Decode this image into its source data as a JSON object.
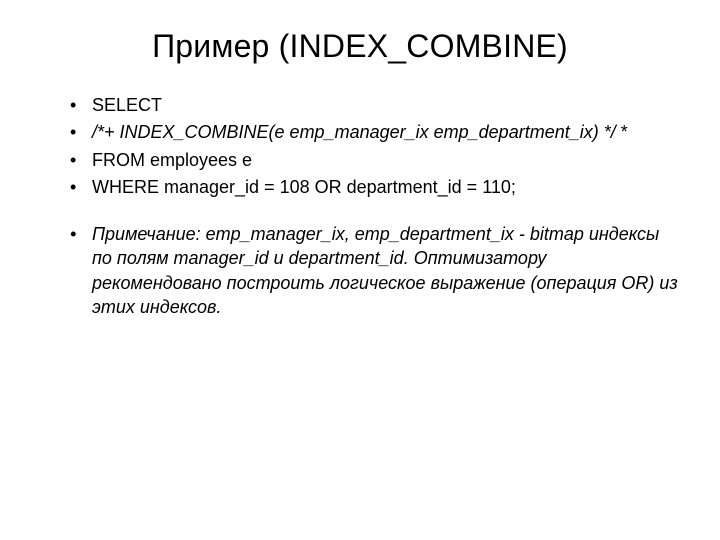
{
  "title": "Пример (INDEX_COMBINE)",
  "lines": {
    "l1": "SELECT",
    "l2_hint": "  /*+ INDEX_COMBINE(e emp_manager_ix emp_department_ix) */",
    "l2_suffix": " *",
    "l3": "FROM employees e",
    "l4": "WHERE manager_id = 108 OR department_id = 110;",
    "note": "Примечание: emp_manager_ix, emp_department_ix  - bitmap индексы по полям manager_id  и department_id. Оптимизатору рекомендовано построить логическое выражение (операция OR) из этих индексов."
  }
}
